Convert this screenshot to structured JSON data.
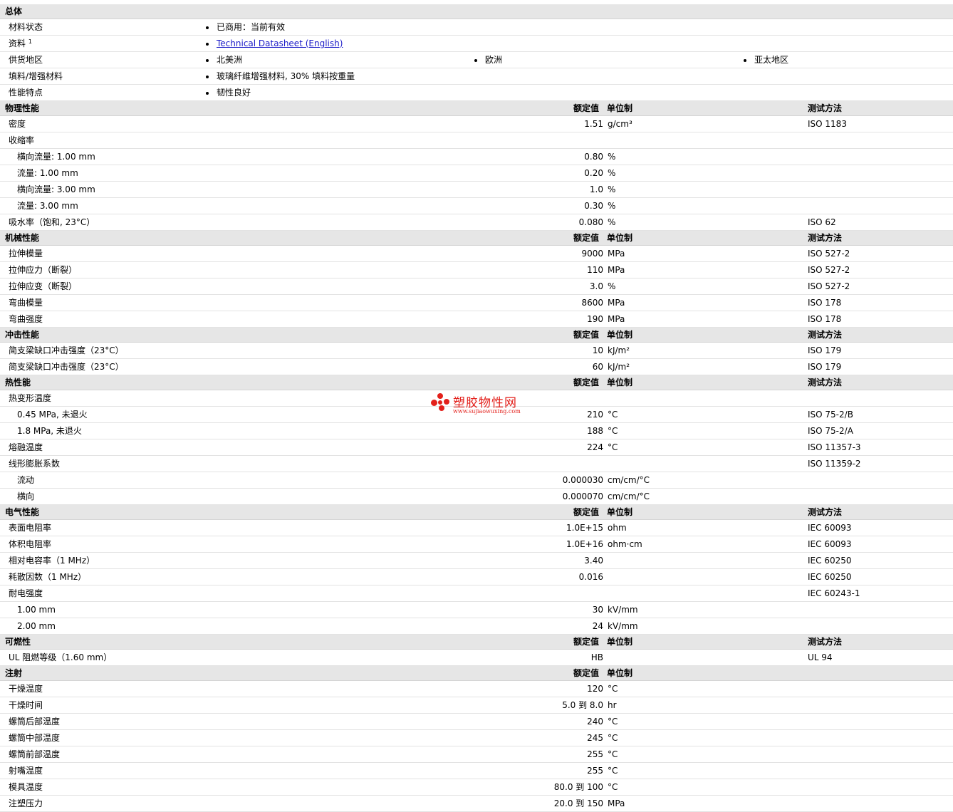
{
  "headers": {
    "value": "额定值",
    "unit": "单位制",
    "test": "测试方法"
  },
  "general": {
    "title": "总体",
    "rows": [
      {
        "label": "材料状态",
        "values": [
          "已商用：当前有效"
        ]
      },
      {
        "label": "资料",
        "sup": "1",
        "values": [
          "Technical Datasheet (English)"
        ],
        "link": true
      },
      {
        "label": "供货地区",
        "values": [
          "北美洲",
          "欧洲",
          "亚太地区"
        ]
      },
      {
        "label": "填料/增强材料",
        "values": [
          "玻璃纤维增强材料, 30% 填料按重量"
        ]
      },
      {
        "label": "性能特点",
        "values": [
          "韧性良好"
        ]
      }
    ]
  },
  "sections": [
    {
      "title": "物理性能",
      "show_test": true,
      "rows": [
        {
          "label": "密度",
          "value": "1.51",
          "unit": "g/cm³",
          "test": "ISO 1183"
        },
        {
          "label": "收缩率",
          "value": "",
          "unit": "",
          "test": ""
        },
        {
          "label": "横向流量: 1.00 mm",
          "sub": true,
          "value": "0.80",
          "unit": "%",
          "test": ""
        },
        {
          "label": "流量: 1.00 mm",
          "sub": true,
          "value": "0.20",
          "unit": "%",
          "test": ""
        },
        {
          "label": "横向流量: 3.00 mm",
          "sub": true,
          "value": "1.0",
          "unit": "%",
          "test": ""
        },
        {
          "label": "流量: 3.00 mm",
          "sub": true,
          "value": "0.30",
          "unit": "%",
          "test": ""
        },
        {
          "label": "吸水率（饱和, 23°C）",
          "value": "0.080",
          "unit": "%",
          "test": "ISO 62"
        }
      ]
    },
    {
      "title": "机械性能",
      "show_test": true,
      "rows": [
        {
          "label": "拉伸模量",
          "value": "9000",
          "unit": "MPa",
          "test": "ISO 527-2"
        },
        {
          "label": "拉伸应力（断裂）",
          "value": "110",
          "unit": "MPa",
          "test": "ISO 527-2"
        },
        {
          "label": "拉伸应变（断裂）",
          "value": "3.0",
          "unit": "%",
          "test": "ISO 527-2"
        },
        {
          "label": "弯曲模量",
          "value": "8600",
          "unit": "MPa",
          "test": "ISO 178"
        },
        {
          "label": "弯曲强度",
          "value": "190",
          "unit": "MPa",
          "test": "ISO 178"
        }
      ]
    },
    {
      "title": "冲击性能",
      "show_test": true,
      "rows": [
        {
          "label": "简支梁缺口冲击强度（23°C）",
          "value": "10",
          "unit": "kJ/m²",
          "test": "ISO 179"
        },
        {
          "label": "简支梁缺口冲击强度（23°C）",
          "value": "60",
          "unit": "kJ/m²",
          "test": "ISO 179"
        }
      ]
    },
    {
      "title": "热性能",
      "show_test": true,
      "rows": [
        {
          "label": "热变形温度",
          "value": "",
          "unit": "",
          "test": ""
        },
        {
          "label": "0.45 MPa, 未退火",
          "sub": true,
          "value": "210",
          "unit": "°C",
          "test": "ISO 75-2/B"
        },
        {
          "label": "1.8 MPa, 未退火",
          "sub": true,
          "value": "188",
          "unit": "°C",
          "test": "ISO 75-2/A"
        },
        {
          "label": "熔融温度",
          "value": "224",
          "unit": "°C",
          "test": "ISO 11357-3"
        },
        {
          "label": "线形膨胀系数",
          "value": "",
          "unit": "",
          "test": "ISO 11359-2"
        },
        {
          "label": "流动",
          "sub": true,
          "value": "0.000030",
          "unit": "cm/cm/°C",
          "test": ""
        },
        {
          "label": "横向",
          "sub": true,
          "value": "0.000070",
          "unit": "cm/cm/°C",
          "test": ""
        }
      ]
    },
    {
      "title": "电气性能",
      "show_test": true,
      "rows": [
        {
          "label": "表面电阻率",
          "value": "1.0E+15",
          "unit": "ohm",
          "test": "IEC 60093"
        },
        {
          "label": "体积电阻率",
          "value": "1.0E+16",
          "unit": "ohm·cm",
          "test": "IEC 60093"
        },
        {
          "label": "相对电容率（1 MHz）",
          "value": "3.40",
          "unit": "",
          "test": "IEC 60250"
        },
        {
          "label": "耗散因数（1 MHz）",
          "value": "0.016",
          "unit": "",
          "test": "IEC 60250"
        },
        {
          "label": "耐电强度",
          "value": "",
          "unit": "",
          "test": "IEC 60243-1"
        },
        {
          "label": "1.00 mm",
          "sub": true,
          "value": "30",
          "unit": "kV/mm",
          "test": ""
        },
        {
          "label": "2.00 mm",
          "sub": true,
          "value": "24",
          "unit": "kV/mm",
          "test": ""
        }
      ]
    },
    {
      "title": "可燃性",
      "show_test": true,
      "rows": [
        {
          "label": "UL 阻燃等级（1.60 mm）",
          "value": "HB",
          "unit": "",
          "test": "UL 94"
        }
      ]
    },
    {
      "title": "注射",
      "show_test": false,
      "rows": [
        {
          "label": "干燥温度",
          "value": "120",
          "unit": "°C",
          "test": ""
        },
        {
          "label": "干燥时间",
          "value": "5.0 到  8.0",
          "unit": "hr",
          "test": ""
        },
        {
          "label": "螺筒后部温度",
          "value": "240",
          "unit": "°C",
          "test": ""
        },
        {
          "label": "螺筒中部温度",
          "value": "245",
          "unit": "°C",
          "test": ""
        },
        {
          "label": "螺筒前部温度",
          "value": "255",
          "unit": "°C",
          "test": ""
        },
        {
          "label": "射嘴温度",
          "value": "255",
          "unit": "°C",
          "test": ""
        },
        {
          "label": "模具温度",
          "value": "80.0 到  100",
          "unit": "°C",
          "test": ""
        },
        {
          "label": "注塑压力",
          "value": "20.0 到  150",
          "unit": "MPa",
          "test": ""
        }
      ]
    }
  ],
  "watermark": {
    "name": "塑胶物性网",
    "url": "www.sujiaowuxing.com"
  }
}
